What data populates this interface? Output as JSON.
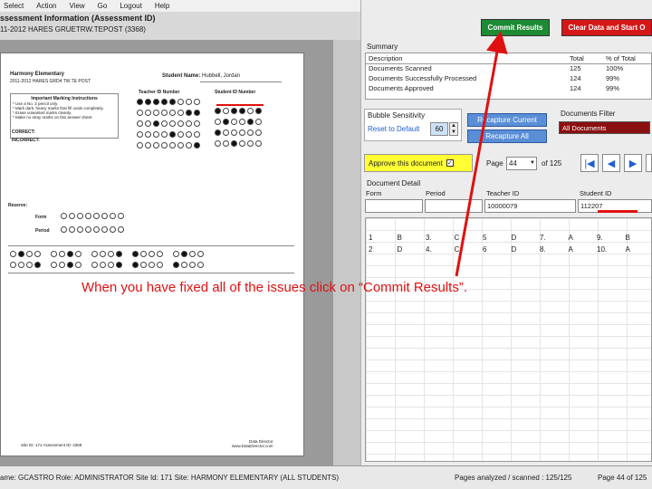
{
  "menu": [
    "Select",
    "Action",
    "View",
    "Go",
    "Logout",
    "Help"
  ],
  "app_title": "ssessment Information (Assessment ID)",
  "app_subtitle": "11-2012 HARES GRUETRW.TEPOST (3368)",
  "sheet": {
    "school": "Harmony Elementary",
    "test_name": "2011-2012 HARES GRD4 TW.TE POST",
    "student_name_label": "Student Name:",
    "student_name": "Hubbell, Jordan",
    "teacher_id_label": "Teacher ID Number",
    "student_id_label": "Student ID Number",
    "instructions_title": "Important Marking Instructions",
    "instructions": [
      "* Use a No. 2 pencil only.",
      "* Mark dark, heavy marks that fill ovals completely.",
      "* Erase unwanted marks cleanly.",
      "* Make no stray marks on this answer sheet."
    ],
    "correct_label": "CORRECT:",
    "incorrect_label": "INCORRECT:",
    "reserved_label": "Reserve:",
    "form_label": "Form",
    "period_label": "Period",
    "footer_left": "Site ID: 171  Assessment ID: 3368",
    "footer_right": "Data Director\nwww.DataDirector.com"
  },
  "buttons": {
    "commit": "Commit Results",
    "clear": "Clear Data and Start O",
    "recapture_current": "Recapture Current",
    "recapture_all": "Recapture All",
    "approve": "Approve this document"
  },
  "summary": {
    "title": "Summary",
    "headers": [
      "Description",
      "Total",
      "% of Total"
    ],
    "rows": [
      [
        "Documents Scanned",
        "125",
        "100%"
      ],
      [
        "Documents Successfully Processed",
        "124",
        "99%"
      ],
      [
        "Documents Approved",
        "124",
        "99%"
      ]
    ]
  },
  "bubble_sensitivity": {
    "title": "Bubble Sensitivity",
    "reset_label": "Reset to Default",
    "value": "60"
  },
  "documents_filter": {
    "title": "Documents Filter",
    "value": "All Documents"
  },
  "page_nav": {
    "label": "Page",
    "value": "44",
    "of_label": "of 125"
  },
  "document_detail": {
    "title": "Document Detail",
    "headers": [
      "Form",
      "Period",
      "Teacher ID",
      "Student ID"
    ],
    "values": [
      "",
      "",
      "10000079",
      "112207"
    ],
    "answers": [
      [
        "1",
        "B",
        "3.",
        "C",
        "5",
        "D",
        "7.",
        "A",
        "9.",
        "B"
      ],
      [
        "2",
        "D",
        "4.",
        "C",
        "6",
        "D",
        "8.",
        "A",
        "10.",
        "A"
      ]
    ]
  },
  "status": {
    "user": "ame: GCASTRO  Role: ADMINISTRATOR  Site Id: 171  Site: HARMONY ELEMENTARY (ALL STUDENTS)",
    "pages": "Pages analyzed / scanned : 125/125",
    "page_of": "Page 44 of 125"
  },
  "caption": "When you have fixed all of the issues click on “Commit Results”.",
  "colors": {
    "commit": "#1d8a34",
    "clear": "#d41818",
    "approve": "#ffff33",
    "filter": "#8b1010",
    "arrow": "#e01010",
    "caption": "#e01010"
  },
  "icons": [
    "first-page-icon",
    "prev-page-icon",
    "next-page-icon",
    "checkbox-icon"
  ]
}
